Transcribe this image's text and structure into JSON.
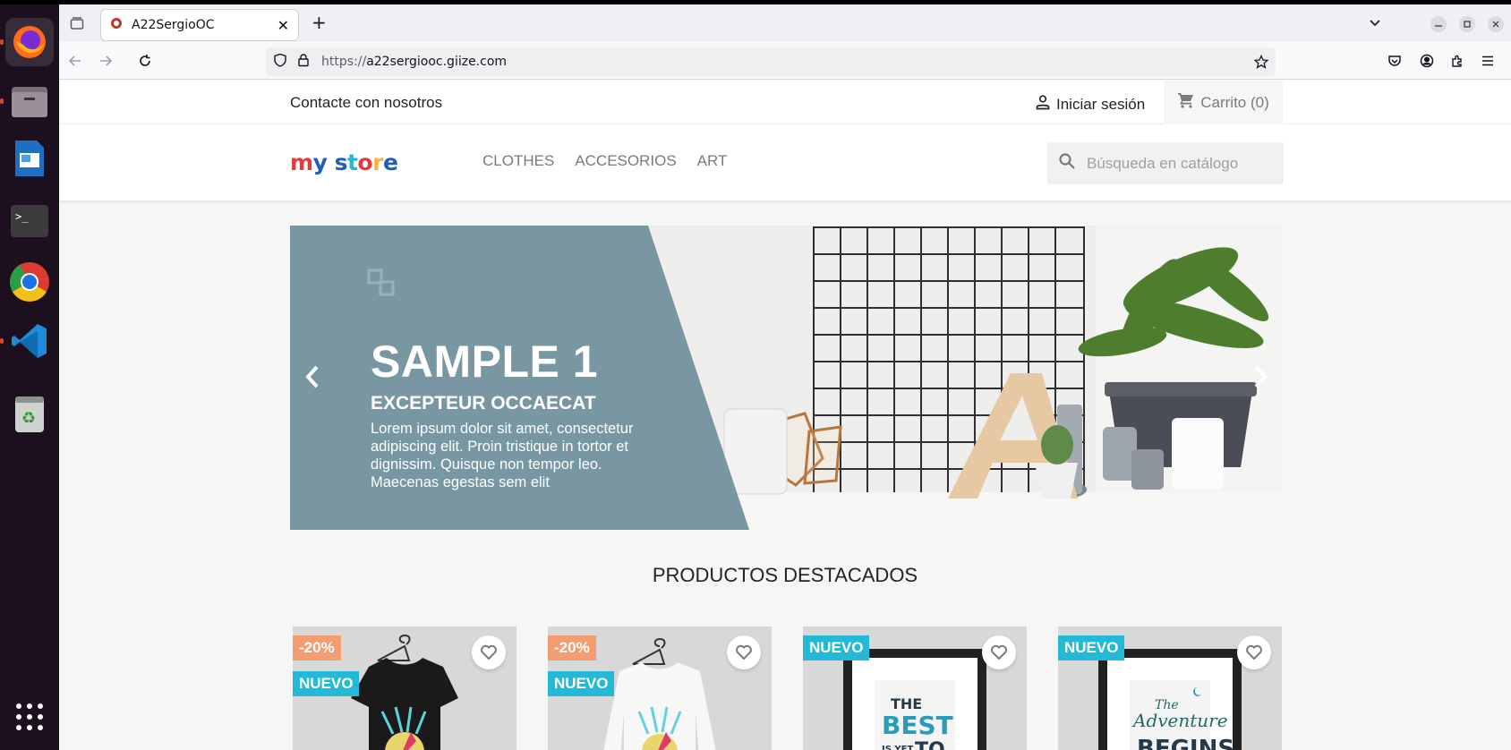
{
  "browser": {
    "tab_title": "A22SergioOC",
    "url_prefix": "https://",
    "url_host": "a22sergiooc.giize.com"
  },
  "header": {
    "contact": "Contacte con nosotros",
    "login": "Iniciar sesión",
    "cart": "Carrito (0)"
  },
  "logo": {
    "letters": [
      "m",
      "y",
      " ",
      "s",
      "t",
      "o",
      "r",
      "e"
    ],
    "colors": [
      "#e53a3a",
      "#1f5fb8",
      "#ffffff",
      "#1f5fb8",
      "#2ab3d6",
      "#e53a3a",
      "#f2b63c",
      "#1f5fb8"
    ]
  },
  "menu": [
    "CLOTHES",
    "ACCESORIOS",
    "ART"
  ],
  "search": {
    "placeholder": "Búsqueda en catálogo"
  },
  "slider": {
    "title": "SAMPLE 1",
    "subtitle": "EXCEPTEUR OCCAECAT",
    "text": "Lorem ipsum dolor sit amet, consectetur adipiscing elit. Proin tristique in tortor et dignissim. Quisque non tempor leo. Maecenas egestas sem elit"
  },
  "featured": {
    "title": "PRODUCTOS DESTACADOS",
    "products": [
      {
        "discount": "-20%",
        "new": "NUEVO"
      },
      {
        "discount": "-20%",
        "new": "NUEVO"
      },
      {
        "discount": "",
        "new": "NUEVO"
      },
      {
        "discount": "",
        "new": "NUEVO"
      }
    ]
  },
  "colors": {
    "slide_panel": "#7996a3",
    "discount_badge": "#f39d72",
    "new_badge": "#24b9d7"
  }
}
